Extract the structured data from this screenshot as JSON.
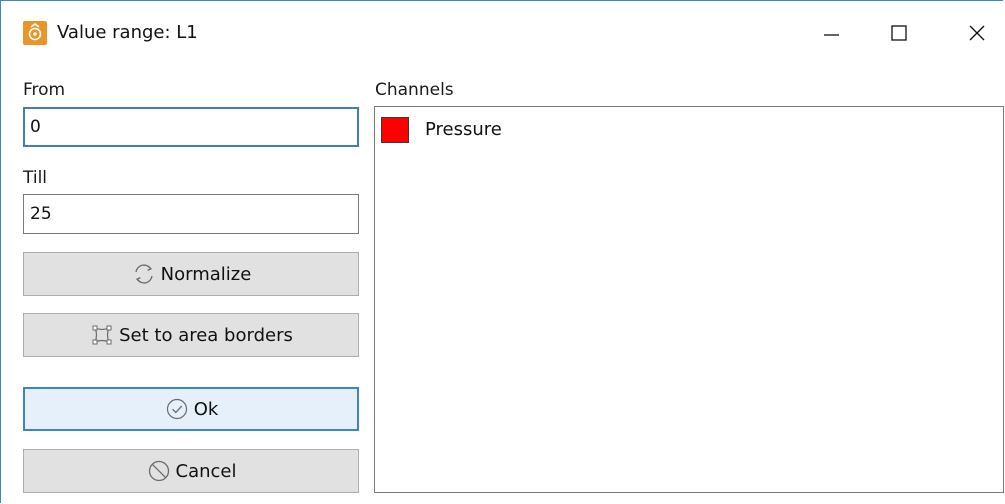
{
  "window": {
    "title": "Value range: L1",
    "icon": "app-logo-icon",
    "controls": [
      "minimize-icon",
      "maximize-icon",
      "close-icon"
    ]
  },
  "form": {
    "from_label": "From",
    "from_value": "0",
    "till_label": "Till",
    "till_value": "25"
  },
  "buttons": {
    "normalize_label": "Normalize",
    "normalize_icon": "refresh-icon",
    "borders_label": "Set to area borders",
    "borders_icon": "area-borders-icon",
    "ok_label": "Ok",
    "ok_icon": "check-circle-icon",
    "cancel_label": "Cancel",
    "cancel_icon": "prohibited-icon"
  },
  "channels": {
    "label": "Channels",
    "items": [
      {
        "name": "Pressure",
        "color": "#ff0000"
      }
    ]
  },
  "colors": {
    "accent": "#3c84c8",
    "app_icon": "#e8962a"
  }
}
